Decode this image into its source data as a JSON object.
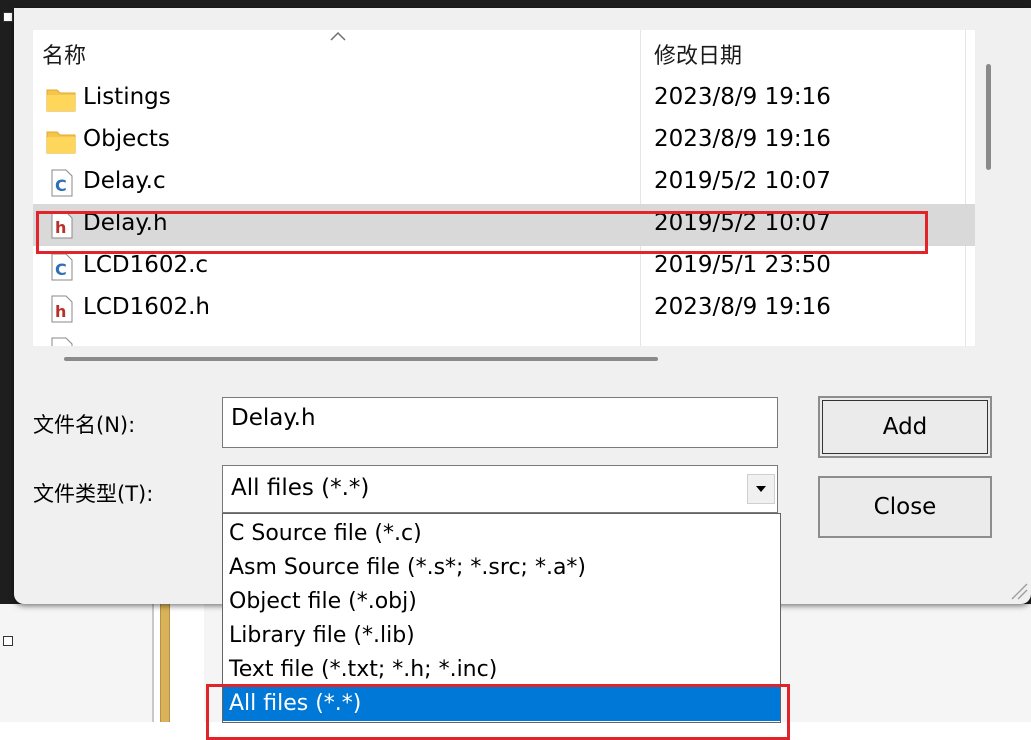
{
  "header": {
    "name_col": "名称",
    "date_col": "修改日期",
    "sort_icon": "chevron-up-icon"
  },
  "files": [
    {
      "name": "Listings",
      "date": "2023/8/9 19:16",
      "icon": "folder-icon"
    },
    {
      "name": "Objects",
      "date": "2023/8/9 19:16",
      "icon": "folder-icon"
    },
    {
      "name": "Delay.c",
      "date": "2019/5/2 10:07",
      "icon": "c-source-file-icon"
    },
    {
      "name": "Delay.h",
      "date": "2019/5/2 10:07",
      "icon": "h-header-file-icon",
      "selected": true
    },
    {
      "name": "LCD1602.c",
      "date": "2019/5/1 23:50",
      "icon": "c-source-file-icon"
    },
    {
      "name": "LCD1602.h",
      "date": "2023/8/9 19:16",
      "icon": "h-header-file-icon"
    }
  ],
  "form": {
    "filename_label": "文件名(N):",
    "filename_value": "Delay.h",
    "filetype_label": "文件类型(T):",
    "filetype_value": "All files (*.*)"
  },
  "buttons": {
    "add": "Add",
    "close": "Close"
  },
  "filetype_options": [
    "C Source file (*.c)",
    "Asm Source file (*.s*; *.src; *.a*)",
    "Object file (*.obj)",
    "Library file (*.lib)",
    "Text file (*.txt; *.h; *.inc)",
    "All files (*.*)"
  ],
  "colors": {
    "selection": "#0078d7",
    "highlight_box": "#e0242a",
    "folder": "#f7c54a"
  }
}
